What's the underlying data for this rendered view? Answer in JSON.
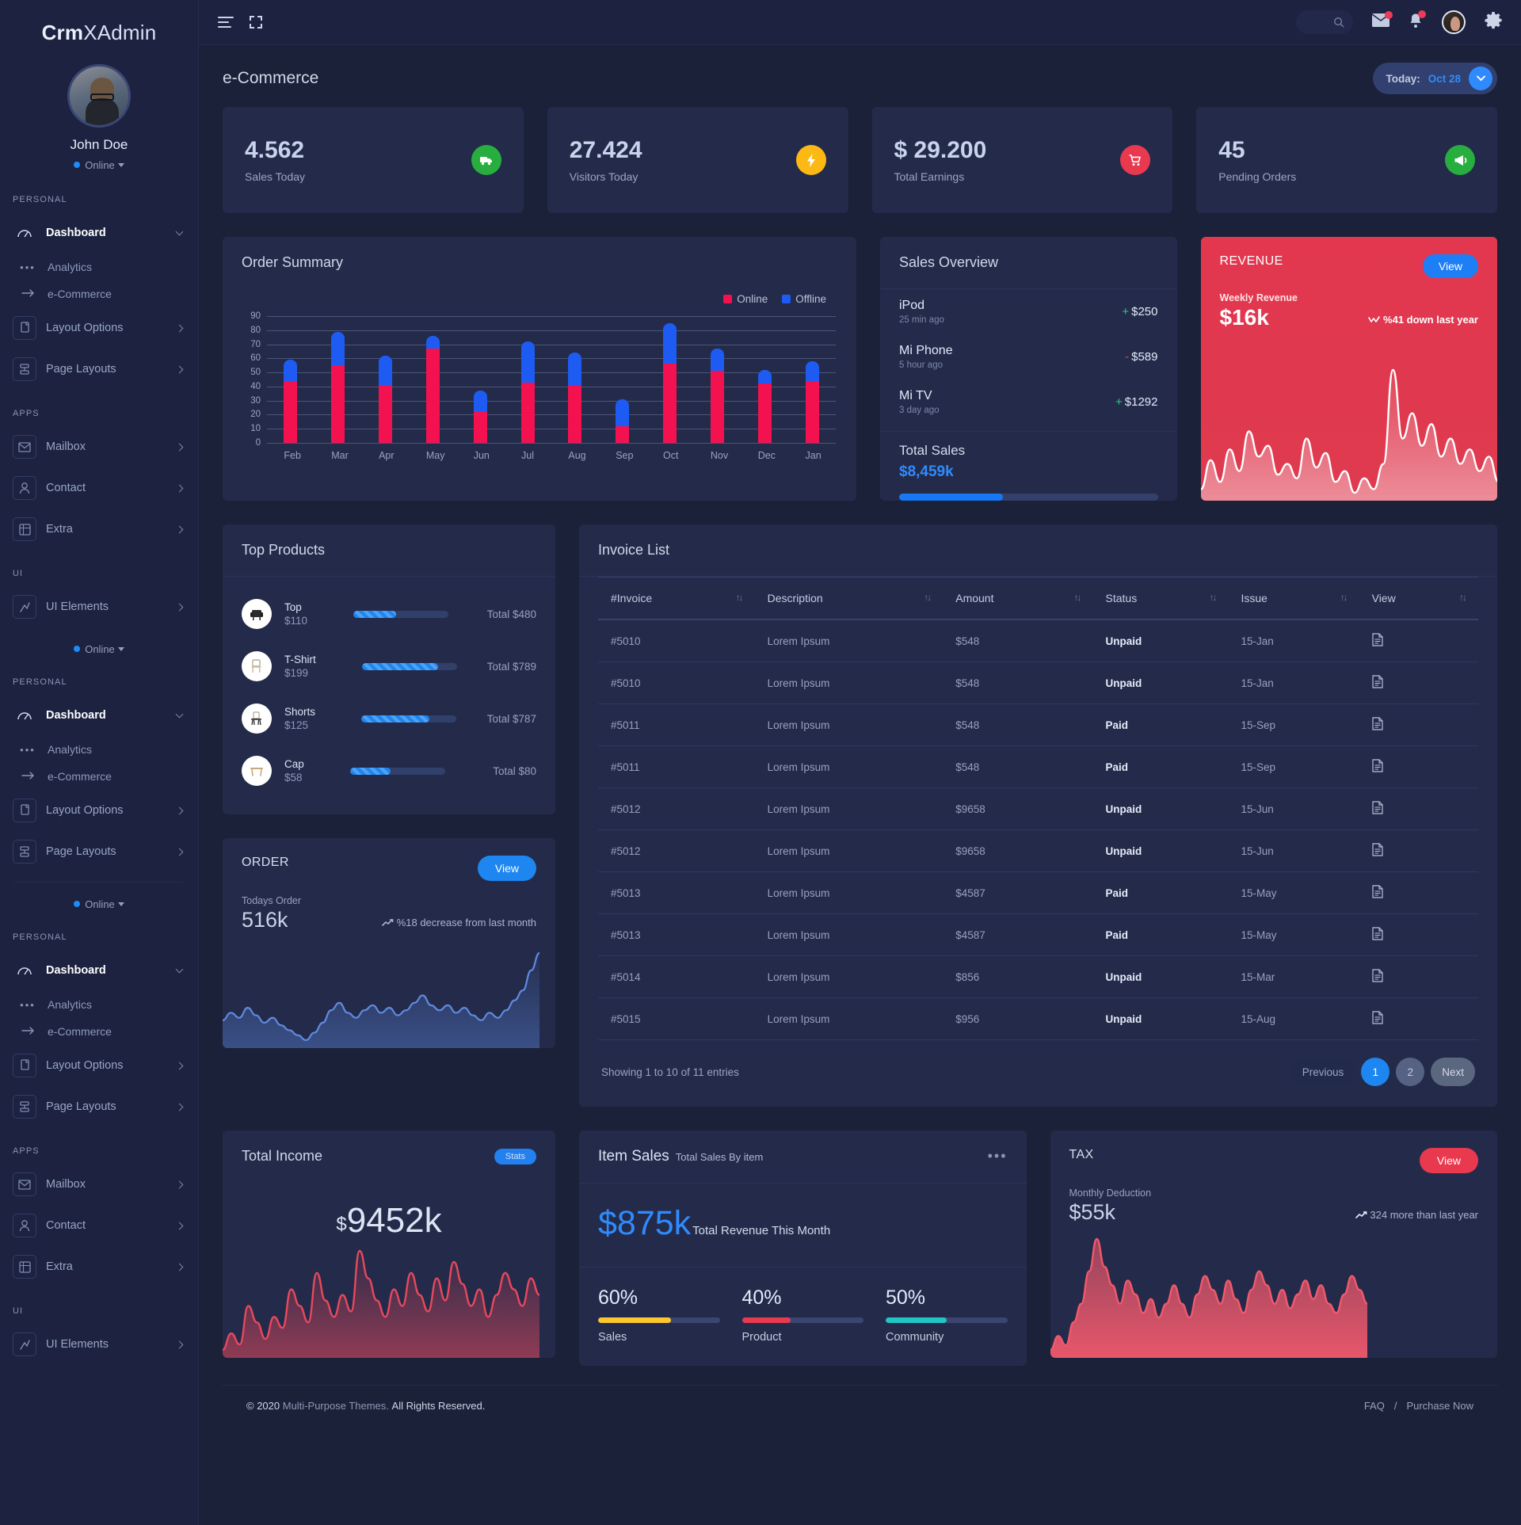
{
  "brand": {
    "part1": "Crm",
    "part2": "XAdmin"
  },
  "profile": {
    "name": "John Doe",
    "status": "Online"
  },
  "sidebar": {
    "sections": [
      {
        "label": "PERSONAL",
        "items": [
          {
            "label": "Dashboard",
            "icon": "dashboard-icon",
            "active": true,
            "expanded": true
          },
          {
            "label": "Analytics",
            "icon": "dots-icon",
            "sub": true
          },
          {
            "label": "e-Commerce",
            "icon": "arrow-right-icon",
            "sub": true
          },
          {
            "label": "Layout Options",
            "icon": "layers-icon",
            "chevron": true
          },
          {
            "label": "Page Layouts",
            "icon": "pages-icon",
            "chevron": true
          }
        ]
      },
      {
        "label": "APPS",
        "items": [
          {
            "label": "Mailbox",
            "icon": "mail-icon",
            "chevron": true
          },
          {
            "label": "Contact",
            "icon": "user-icon",
            "chevron": true
          },
          {
            "label": "Extra",
            "icon": "grid-icon",
            "chevron": true
          }
        ]
      },
      {
        "label": "UI",
        "items": [
          {
            "label": "UI Elements",
            "icon": "ui-icon",
            "chevron": true
          }
        ]
      }
    ]
  },
  "topbar": {
    "search_placeholder": "",
    "icons": [
      "menu-icon",
      "expand-icon",
      "search-icon",
      "mail-icon",
      "bell-icon",
      "avatar",
      "gear-icon"
    ]
  },
  "page": {
    "title": "e-Commerce",
    "date_label": "Today:",
    "date_value": "Oct 28"
  },
  "stats": [
    {
      "value": "4.562",
      "label": "Sales Today",
      "icon": "truck-icon",
      "color": "#27ae3f"
    },
    {
      "value": "27.424",
      "label": "Visitors Today",
      "icon": "bolt-icon",
      "color": "#fdb913"
    },
    {
      "value": "$ 29.200",
      "label": "Total Earnings",
      "icon": "cart-icon",
      "color": "#e8394f"
    },
    {
      "value": "45",
      "label": "Pending Orders",
      "icon": "megaphone-icon",
      "color": "#27ae3f"
    }
  ],
  "order_summary": {
    "title": "Order Summary"
  },
  "chart_data": {
    "type": "bar",
    "title": "Order Summary",
    "stacked": true,
    "categories": [
      "Feb",
      "Mar",
      "Apr",
      "May",
      "Jun",
      "Jul",
      "Aug",
      "Sep",
      "Oct",
      "Nov",
      "Dec",
      "Jan"
    ],
    "series": [
      {
        "name": "Online",
        "color": "#f3124f",
        "values": [
          44,
          55,
          41,
          67,
          22,
          43,
          41,
          12,
          56,
          51,
          42,
          44
        ]
      },
      {
        "name": "Offline",
        "color": "#1d5bf2",
        "values": [
          15,
          24,
          21,
          9,
          15,
          29,
          23,
          19,
          29,
          16,
          10,
          14
        ]
      }
    ],
    "totals": [
      59,
      79,
      62,
      76,
      37,
      72,
      64,
      31,
      85,
      67,
      52,
      58
    ],
    "ylim": [
      0,
      90
    ],
    "yticks": [
      0,
      10,
      20,
      30,
      40,
      50,
      60,
      70,
      80,
      90
    ],
    "ylabel": "",
    "xlabel": "",
    "grid": true,
    "legend": {
      "position": "top-right",
      "entries": [
        "Online",
        "Offline"
      ]
    }
  },
  "sales_overview": {
    "title": "Sales Overview",
    "items": [
      {
        "name": "iPod",
        "time": "25 min ago",
        "sign": "+",
        "amount": "$250",
        "positive": true
      },
      {
        "name": "Mi Phone",
        "time": "5 hour ago",
        "sign": "-",
        "amount": "$589",
        "positive": false
      },
      {
        "name": "Mi TV",
        "time": "3 day ago",
        "sign": "+",
        "amount": "$1292",
        "positive": true
      }
    ],
    "total_label": "Total Sales",
    "total_value": "$8,459k",
    "progress_percent": 40
  },
  "revenue_card": {
    "title": "REVENUE",
    "button": "View",
    "subtitle": "Weekly Revenue",
    "value": "$16k",
    "delta": "%41 down last year",
    "accent": "#e0394f",
    "sparkline": [
      30,
      46,
      34,
      52,
      40,
      62,
      48,
      54,
      38,
      44,
      36,
      58,
      42,
      50,
      34,
      40,
      28,
      36,
      30,
      44,
      96,
      58,
      72,
      54,
      66,
      48,
      58,
      44,
      52,
      40,
      48,
      34,
      42,
      30
    ]
  },
  "top_products": {
    "title": "Top Products",
    "items": [
      {
        "name": "Top",
        "price": "$110",
        "percent": 45,
        "total": "Total $480",
        "icon": "armchair-icon"
      },
      {
        "name": "T-Shirt",
        "price": "$199",
        "percent": 80,
        "total": "Total $789",
        "icon": "chair-icon"
      },
      {
        "name": "Shorts",
        "price": "$125",
        "percent": 72,
        "total": "Total $787",
        "icon": "stool-icon"
      },
      {
        "name": "Cap",
        "price": "$58",
        "percent": 43,
        "total": "Total $80",
        "icon": "table-icon"
      }
    ]
  },
  "order_card": {
    "title": "ORDER",
    "button": "View",
    "subtitle": "Todays Order",
    "value": "516k",
    "delta": "%18 decrease from last month",
    "sparkline": [
      38,
      44,
      40,
      48,
      42,
      36,
      40,
      34,
      30,
      26,
      22,
      28,
      36,
      46,
      52,
      44,
      40,
      46,
      50,
      44,
      48,
      42,
      46,
      52,
      58,
      50,
      46,
      50,
      44,
      48,
      42,
      38,
      44,
      40,
      46,
      54,
      62,
      78,
      92
    ]
  },
  "invoice_list": {
    "title": "Invoice List",
    "columns": [
      "#Invoice",
      "Description",
      "Amount",
      "Status",
      "Issue",
      "View"
    ],
    "rows": [
      {
        "invoice": "#5010",
        "description": "Lorem Ipsum",
        "amount": "$548",
        "status": "Unpaid",
        "issue": "15-Jan",
        "view": "doc-icon"
      },
      {
        "invoice": "#5010",
        "description": "Lorem Ipsum",
        "amount": "$548",
        "status": "Unpaid",
        "issue": "15-Jan",
        "view": "doc-icon"
      },
      {
        "invoice": "#5011",
        "description": "Lorem Ipsum",
        "amount": "$548",
        "status": "Paid",
        "issue": "15-Sep",
        "view": "doc-icon"
      },
      {
        "invoice": "#5011",
        "description": "Lorem Ipsum",
        "amount": "$548",
        "status": "Paid",
        "issue": "15-Sep",
        "view": "doc-icon"
      },
      {
        "invoice": "#5012",
        "description": "Lorem Ipsum",
        "amount": "$9658",
        "status": "Unpaid",
        "issue": "15-Jun",
        "view": "doc-icon"
      },
      {
        "invoice": "#5012",
        "description": "Lorem Ipsum",
        "amount": "$9658",
        "status": "Unpaid",
        "issue": "15-Jun",
        "view": "doc-icon"
      },
      {
        "invoice": "#5013",
        "description": "Lorem Ipsum",
        "amount": "$4587",
        "status": "Paid",
        "issue": "15-May",
        "view": "doc-icon"
      },
      {
        "invoice": "#5013",
        "description": "Lorem Ipsum",
        "amount": "$4587",
        "status": "Paid",
        "issue": "15-May",
        "view": "doc-icon"
      },
      {
        "invoice": "#5014",
        "description": "Lorem Ipsum",
        "amount": "$856",
        "status": "Unpaid",
        "issue": "15-Mar",
        "view": "doc-icon"
      },
      {
        "invoice": "#5015",
        "description": "Lorem Ipsum",
        "amount": "$956",
        "status": "Unpaid",
        "issue": "15-Aug",
        "view": "doc-icon"
      }
    ],
    "showing": "Showing 1 to 10 of 11 entries",
    "pagination": {
      "previous": "Previous",
      "pages": [
        "1",
        "2"
      ],
      "active": "1",
      "next": "Next"
    }
  },
  "total_income": {
    "title": "Total Income",
    "badge": "Stats",
    "currency": "$",
    "value": "9452k",
    "sparkline": [
      18,
      24,
      20,
      34,
      28,
      22,
      30,
      26,
      40,
      34,
      28,
      46,
      36,
      30,
      38,
      32,
      54,
      44,
      36,
      30,
      40,
      34,
      46,
      38,
      32,
      44,
      36,
      50,
      42,
      34,
      40,
      30,
      38,
      46,
      40,
      34,
      44,
      38
    ]
  },
  "item_sales": {
    "title": "Item Sales",
    "subtitle": "Total Sales By item",
    "value": "$875k",
    "caption": "Total Revenue This Month",
    "stats": [
      {
        "percent": "60%",
        "value": 60,
        "label": "Sales",
        "color": "#fdc52e"
      },
      {
        "percent": "40%",
        "value": 40,
        "label": "Product",
        "color": "#ea3a50"
      },
      {
        "percent": "50%",
        "value": 50,
        "label": "Community",
        "color": "#20c5c5"
      }
    ]
  },
  "tax_card": {
    "title": "TAX",
    "button": "View",
    "subtitle": "Monthly Deduction",
    "value": "$55k",
    "delta": "324 more than last year",
    "sparkline": [
      10,
      16,
      12,
      22,
      30,
      44,
      58,
      46,
      38,
      30,
      40,
      34,
      26,
      32,
      24,
      30,
      38,
      30,
      24,
      34,
      42,
      36,
      30,
      40,
      32,
      26,
      36,
      44,
      38,
      30,
      36,
      28,
      34,
      40,
      32,
      38,
      30,
      26,
      34,
      42,
      36,
      30
    ]
  },
  "footer": {
    "copyright": "© 2020",
    "brand": "Multi-Purpose Themes.",
    "rights": "All Rights Reserved.",
    "links": [
      "FAQ",
      "Purchase Now"
    ],
    "separator": "/"
  }
}
